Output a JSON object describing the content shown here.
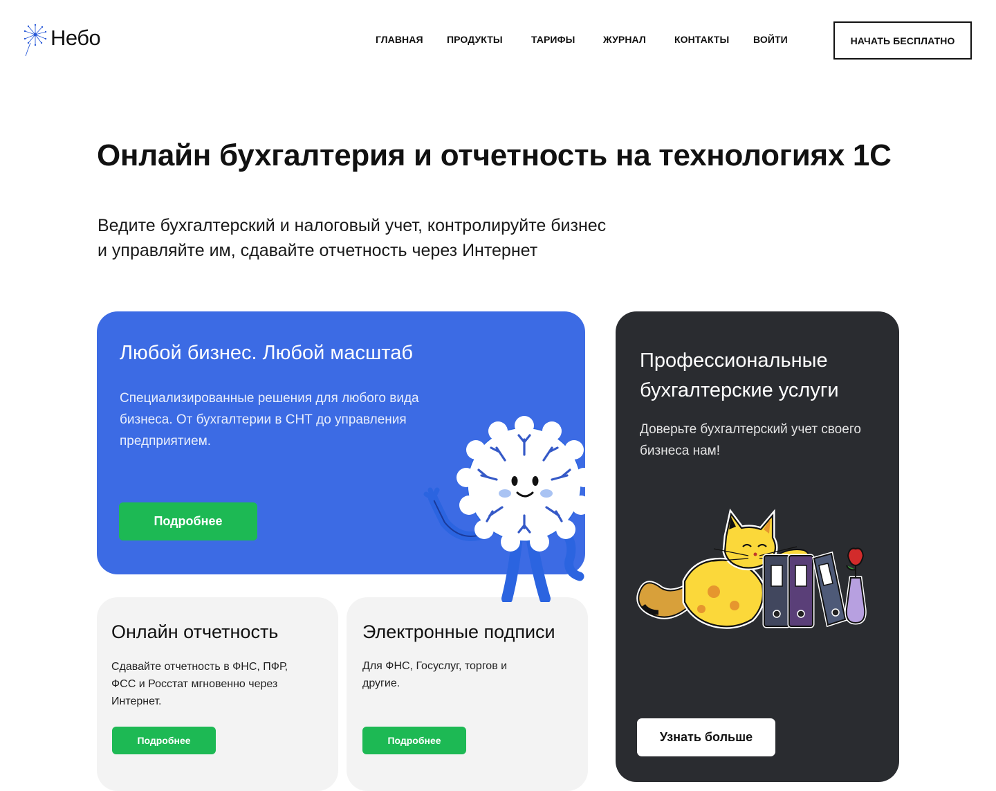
{
  "header": {
    "logo_text": "Небо",
    "nav": [
      {
        "label": "ГЛАВНАЯ"
      },
      {
        "label": "ПРОДУКТЫ"
      },
      {
        "label": "ТАРИФЫ"
      },
      {
        "label": "ЖУРНАЛ"
      },
      {
        "label": "КОНТАКТЫ"
      },
      {
        "label": "ВОЙТИ"
      }
    ],
    "cta_label": "НАЧАТЬ БЕСПЛАТНО"
  },
  "hero": {
    "title": "Онлайн бухгалтерия и отчетность на технологиях 1С",
    "subtitle_line1": "Ведите бухгалтерский и налоговый учет, контролируйте бизнес",
    "subtitle_line2": "и управляйте им, сдавайте отчетность через Интернет"
  },
  "cards": {
    "business": {
      "title": "Любой бизнес. Любой масштаб",
      "text": "Специализированные решения для любого вида бизнеса. От бухгалтерии в СНТ до управления предприятием.",
      "button": "Подробнее",
      "color": "#3c6be4"
    },
    "services": {
      "title": "Профессиональные бухгалтерские услуги",
      "text": "Доверьте бухгалтерский учет своего бизнеса нам!",
      "button": "Узнать больше",
      "color": "#2a2c30"
    },
    "reporting": {
      "title": "Онлайн отчетность",
      "text": "Сдавайте отчетность в ФНС, ПФР, ФСС и Росстат мгновенно через Интернет.",
      "button": "Подробнее"
    },
    "signatures": {
      "title": "Электронные подписи",
      "text": "Для ФНС, Госуслуг, торгов и другие.",
      "button": "Подробнее"
    }
  },
  "colors": {
    "accent_green": "#1db954",
    "grey_card": "#f3f3f3"
  },
  "icons": {
    "logo": "dandelion-icon"
  }
}
